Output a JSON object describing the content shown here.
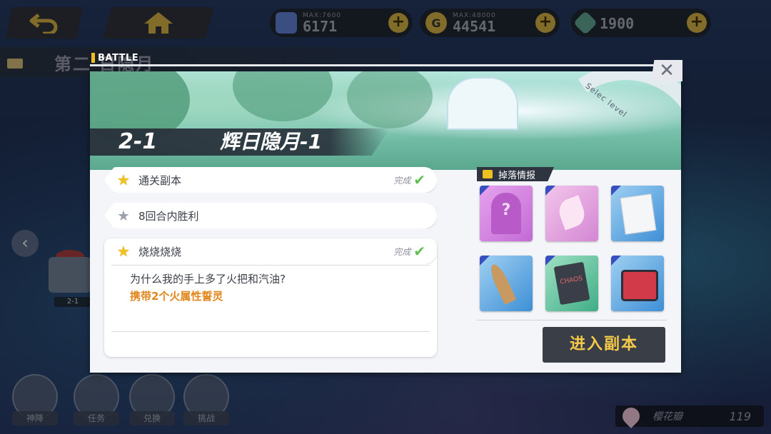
{
  "topbar": {
    "back_icon": "back-arrow-icon",
    "home_icon": "home-icon",
    "resources": [
      {
        "icon": "card-icon",
        "max_label": "MAX:7600",
        "value": "6171"
      },
      {
        "icon": "coin-icon",
        "coin_letter": "G",
        "max_label": "MAX:48000",
        "value": "44541"
      },
      {
        "icon": "gem-icon",
        "value": "1900"
      }
    ],
    "plus_label": "+"
  },
  "stage": {
    "title_partial": "第二 日隐月"
  },
  "battle_tag": "BATTLE",
  "close_label": "✕",
  "banner": {
    "level_id": "2-1",
    "level_name": "辉日隐月-1",
    "select_level_label": "Selec level"
  },
  "missions": [
    {
      "text": "通关副本",
      "star": "gold",
      "status": "完成"
    },
    {
      "text": "8回合内胜利",
      "star": "gray",
      "status": ""
    },
    {
      "text": "烧烧烧烧",
      "star": "gold",
      "status": "完成"
    }
  ],
  "description": {
    "line1": "为什么我的手上多了火把和汽油?",
    "line2": "携带2个火属性誓灵"
  },
  "drops": {
    "label": "掉落情报",
    "items": [
      {
        "icon": "unknown-character-icon",
        "rarity_color": "purple"
      },
      {
        "icon": "sakura-petal-icon",
        "rarity_color": "pink"
      },
      {
        "icon": "scroll-paper-icon",
        "rarity_color": "blue"
      },
      {
        "icon": "feather-quill-icon",
        "rarity_color": "blue"
      },
      {
        "icon": "chaos-book-icon",
        "book_text": "CHAOS",
        "rarity_color": "green"
      },
      {
        "icon": "red-device-icon",
        "rarity_color": "blue"
      }
    ]
  },
  "enter_button": "进入副本",
  "map_node_label": "2-1",
  "bottom_nav": [
    {
      "label": "神降"
    },
    {
      "label": "任务"
    },
    {
      "label": "兑换"
    },
    {
      "label": "挑战"
    }
  ],
  "sakura": {
    "name": "樱花瓣",
    "count": "119"
  },
  "colors": {
    "accent_gold": "#f2c21a",
    "enter_text": "#f5c94a",
    "hint_orange": "#e0861a",
    "check_green": "#5cc04a"
  }
}
